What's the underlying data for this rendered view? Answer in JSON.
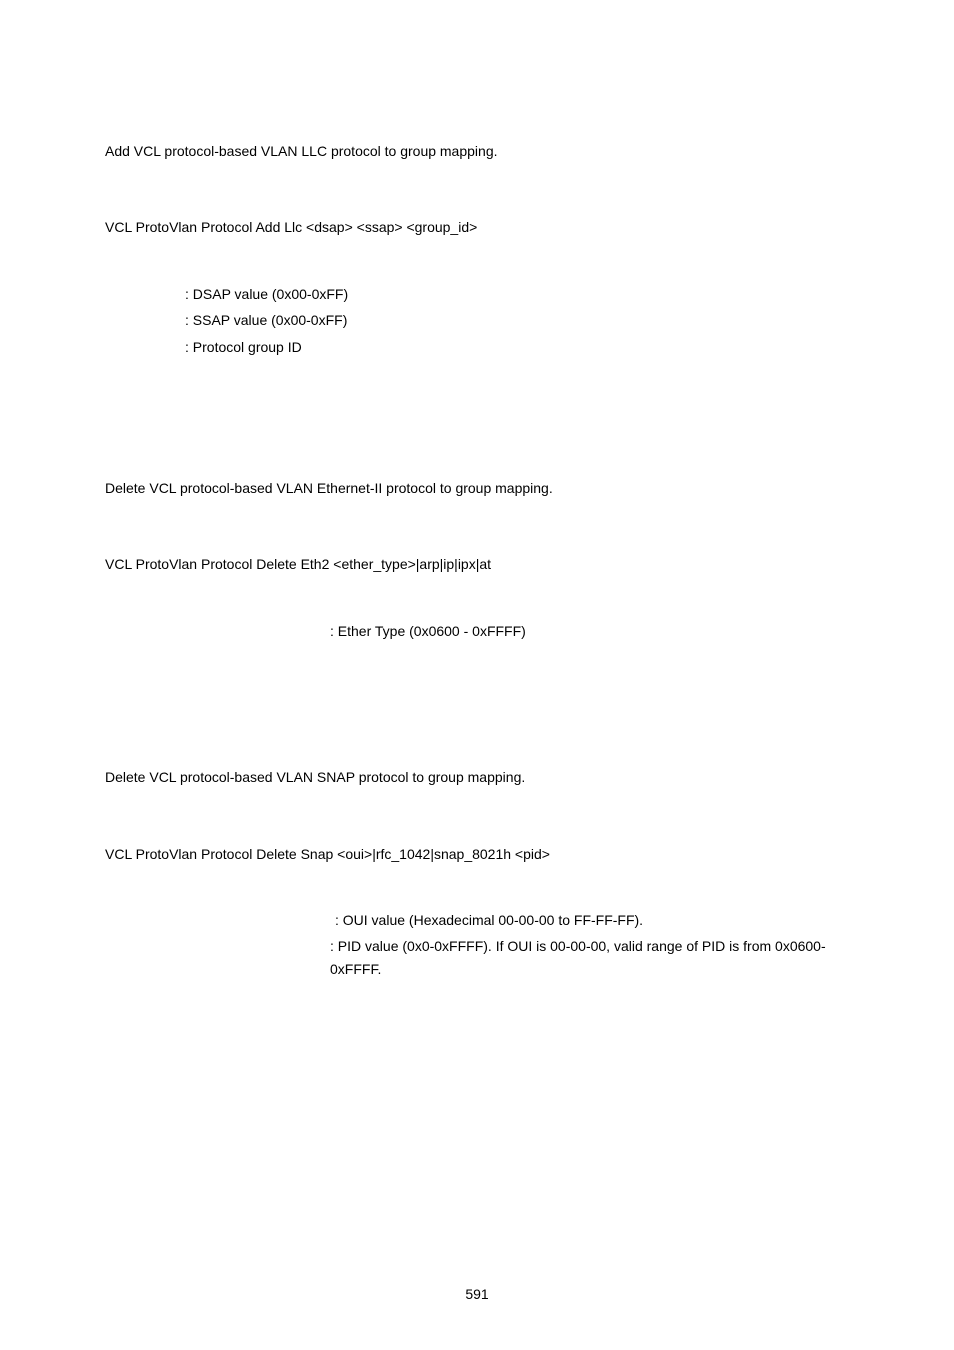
{
  "sec1": {
    "desc": "Add VCL protocol-based VLAN LLC protocol to group mapping.",
    "syntax": "VCL ProtoVlan Protocol Add Llc <dsap> <ssap> <group_id>",
    "params": {
      "dsap": ": DSAP value (0x00-0xFF)",
      "ssap": ": SSAP value (0x00-0xFF)",
      "group": ": Protocol group ID"
    }
  },
  "sec2": {
    "desc": "Delete VCL protocol-based VLAN Ethernet-II protocol to group mapping.",
    "syntax": "VCL ProtoVlan Protocol Delete Eth2 <ether_type>|arp|ip|ipx|at",
    "params": {
      "ether": ": Ether Type (0x0600 - 0xFFFF)"
    }
  },
  "sec3": {
    "desc": "Delete VCL protocol-based VLAN SNAP protocol to group mapping.",
    "syntax": "VCL ProtoVlan Protocol Delete Snap <oui>|rfc_1042|snap_8021h <pid>",
    "params": {
      "oui": ": OUI value (Hexadecimal 00-00-00 to FF-FF-FF).",
      "pid": ": PID value (0x0-0xFFFF). If OUI is 00-00-00, valid range of PID is from 0x0600-0xFFFF."
    }
  },
  "pageNumber": "591"
}
